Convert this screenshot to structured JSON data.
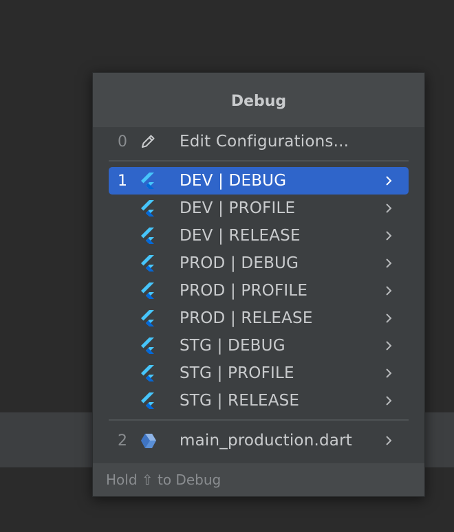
{
  "popup": {
    "title": "Debug",
    "edit": {
      "index": "0",
      "label": "Edit Configurations...",
      "icon": "pencil-icon"
    },
    "configs": [
      {
        "index": "1",
        "label": "DEV | DEBUG",
        "selected": true
      },
      {
        "index": "",
        "label": "DEV | PROFILE"
      },
      {
        "index": "",
        "label": "DEV | RELEASE"
      },
      {
        "index": "",
        "label": "PROD | DEBUG"
      },
      {
        "index": "",
        "label": "PROD | PROFILE"
      },
      {
        "index": "",
        "label": "PROD | RELEASE"
      },
      {
        "index": "",
        "label": "STG | DEBUG"
      },
      {
        "index": "",
        "label": "STG | PROFILE"
      },
      {
        "index": "",
        "label": "STG | RELEASE"
      }
    ],
    "dart_entry": {
      "index": "2",
      "label": "main_production.dart",
      "icon": "dart-file-icon"
    },
    "footer": "Hold ⇧ to Debug"
  },
  "colors": {
    "selected_bg": "#2f65ca",
    "flutter_light": "#47c5fb",
    "flutter_dark": "#0468d7",
    "dart_blue": "#5a8fd6"
  }
}
